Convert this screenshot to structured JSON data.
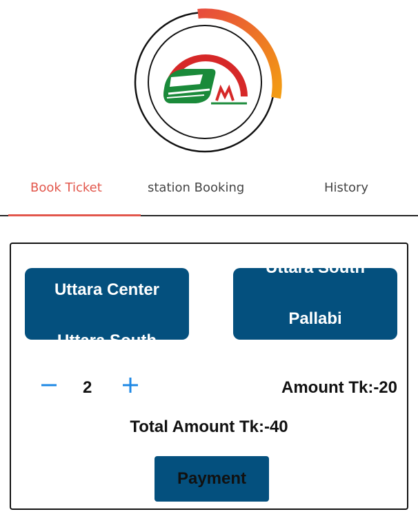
{
  "tabs": [
    {
      "label": "Book Ticket",
      "active": true
    },
    {
      "label": "station Booking",
      "active": false
    },
    {
      "label": "History",
      "active": false
    }
  ],
  "from_picker": {
    "selected": "Uttara Center",
    "next_partial": "Uttara South"
  },
  "to_picker": {
    "previous_partial": "Uttara South",
    "selected": "Pallabi"
  },
  "quantity": {
    "minus_icon": "minus-icon",
    "value": "2",
    "plus_icon": "plus-icon"
  },
  "amount_label": "Amount Tk:-20",
  "total_label": "Total Amount Tk:-40",
  "payment_label": "Payment",
  "colors": {
    "primary": "#04507e",
    "accent_red": "#e2564b",
    "stepper_blue": "#1e88e5",
    "logo_green": "#1a8a3a",
    "logo_red": "#d62828",
    "arc_orange": "#f39c12"
  }
}
